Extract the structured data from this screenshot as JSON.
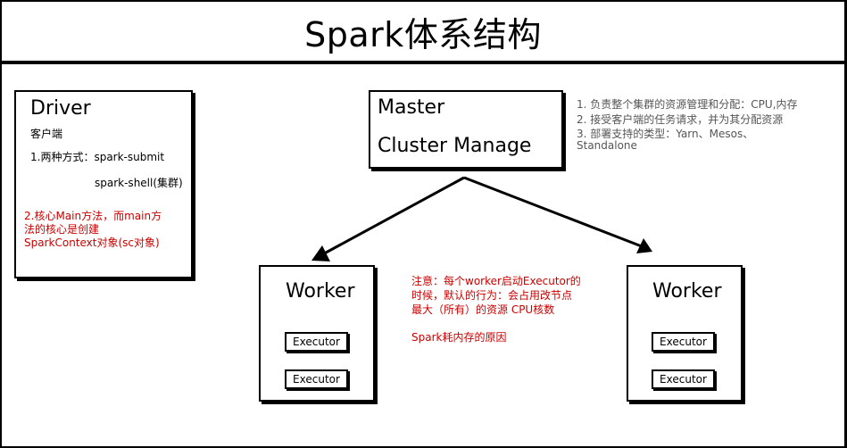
{
  "title": "Spark体系结构",
  "driver": {
    "heading": "Driver",
    "subtitle": "客户端",
    "line1": "1.两种方式：spark-submit",
    "line2": "spark-shell(集群)",
    "note_line1": "2.核心Main方法，而main方",
    "note_line2": "法的核心是创建",
    "note_line3": "SparkContext对象(sc对象)"
  },
  "master": {
    "heading1": "Master",
    "heading2": "Cluster Manage"
  },
  "master_notes": {
    "line1": "1. 负责整个集群的资源管理和分配：CPU,内存",
    "line2": "2. 接受客户端的任务请求，并为其分配资源",
    "line3": "3. 部署支持的类型：Yarn、Mesos、",
    "line4": "Standalone"
  },
  "workers": [
    {
      "heading": "Worker",
      "executors": [
        "Executor",
        "Executor"
      ]
    },
    {
      "heading": "Worker",
      "executors": [
        "Executor",
        "Executor"
      ]
    }
  ],
  "worker_note": {
    "line1": "注意：每个worker启动Executor的",
    "line2": "时候，默认的行为：会占用改节点",
    "line3": "最大（所有）的资源 CPU核数",
    "line4": "Spark耗内存的原因"
  },
  "colors": {
    "note_red": "#cc0000",
    "note_grey": "#555555",
    "line": "#000000"
  }
}
